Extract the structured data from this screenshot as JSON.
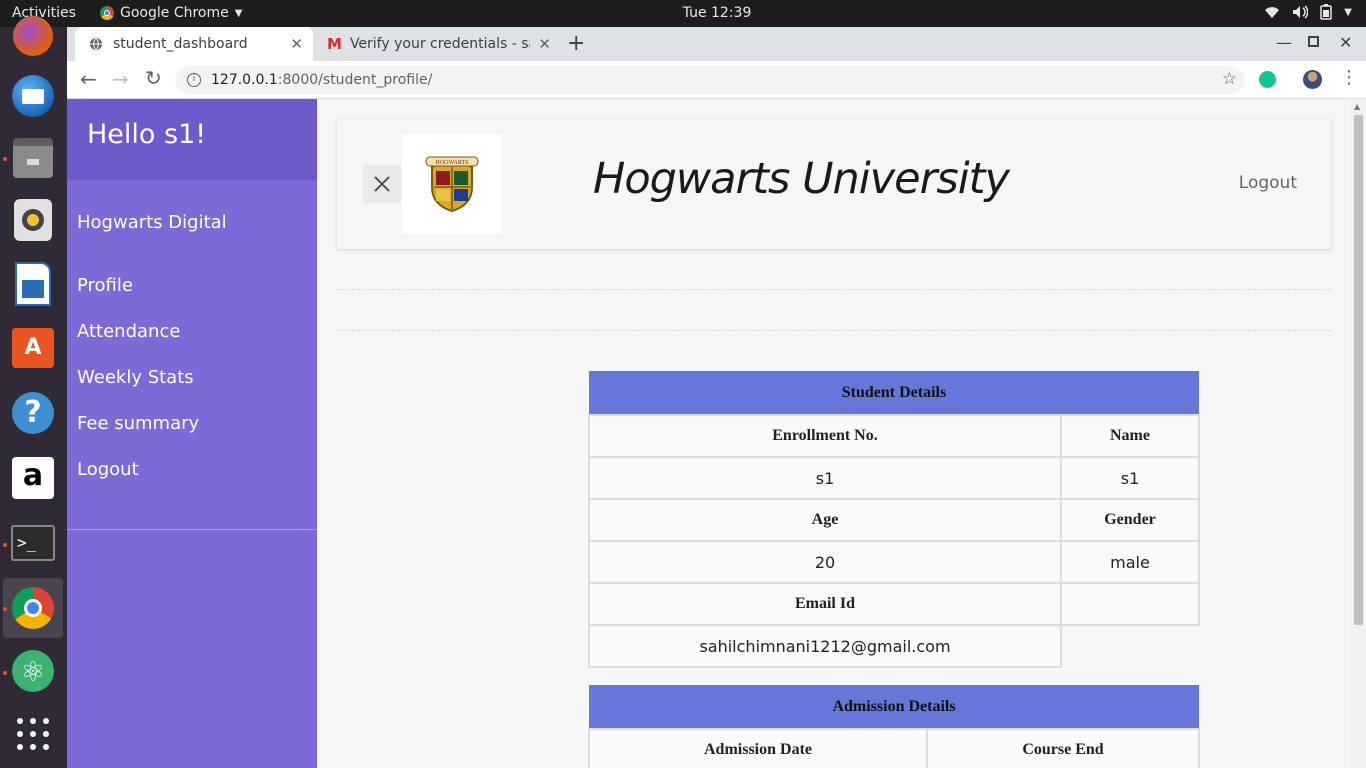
{
  "topbar": {
    "activities": "Activities",
    "app_name": "Google Chrome",
    "clock": "Tue 12:39"
  },
  "dock": {
    "items": [
      "firefox-icon",
      "thunderbird-icon",
      "files-icon",
      "rhythmbox-icon",
      "writer-icon",
      "software-icon",
      "help-icon",
      "amazon-icon",
      "terminal-icon",
      "chrome-icon",
      "atom-icon",
      "apps-grid-icon"
    ]
  },
  "browser": {
    "tabs": [
      {
        "title": "student_dashboard"
      },
      {
        "title": "Verify your credentials - sa"
      }
    ],
    "url_host": "127.0.0.1",
    "url_path": ":8000/student_profile/"
  },
  "sidebar": {
    "greeting": "Hello s1!",
    "brand": "Hogwarts Digital",
    "items": [
      "Profile",
      "Attendance",
      "Weekly Stats",
      "Fee summary",
      "Logout"
    ]
  },
  "header": {
    "title": "Hogwarts University",
    "logout": "Logout",
    "crest_text": "HOGWARTS"
  },
  "student_details": {
    "caption": "Student Details",
    "enrollment_label": "Enrollment No.",
    "name_label": "Name",
    "enrollment": "s1",
    "name": "s1",
    "age_label": "Age",
    "gender_label": "Gender",
    "age": "20",
    "gender": "male",
    "email_label": "Email Id",
    "email": "sahilchimnani1212@gmail.com"
  },
  "admission_details": {
    "caption": "Admission Details",
    "admission_date_label": "Admission Date",
    "course_end_label": "Course End"
  },
  "colors": {
    "sidebar": "#7d6ad7",
    "sidebar_header": "#6d5acb",
    "table_caption": "#6677d9"
  }
}
